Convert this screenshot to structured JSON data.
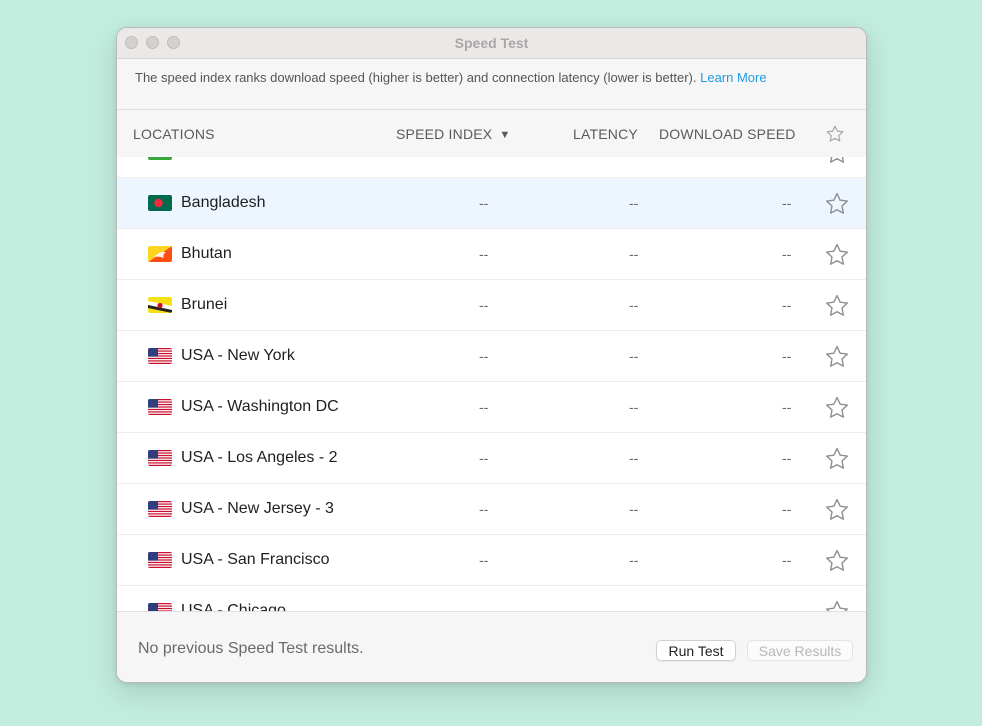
{
  "window": {
    "title": "Speed Test"
  },
  "info": {
    "text": "The speed index ranks download speed (higher is better) and connection latency (lower is better).",
    "link": "Learn More"
  },
  "columns": {
    "locations": "LOCATIONS",
    "speed_index": "SPEED INDEX",
    "sort_arrow": "▼",
    "latency": "LATENCY",
    "download_speed": "DOWNLOAD SPEED"
  },
  "rows": [
    {
      "name": "",
      "flag": "partial-green",
      "speed_index": "",
      "latency": "",
      "download": "",
      "selected": false
    },
    {
      "name": "Bangladesh",
      "flag": "bangladesh",
      "speed_index": "--",
      "latency": "--",
      "download": "--",
      "selected": true
    },
    {
      "name": "Bhutan",
      "flag": "bhutan",
      "speed_index": "--",
      "latency": "--",
      "download": "--",
      "selected": false
    },
    {
      "name": "Brunei",
      "flag": "brunei",
      "speed_index": "--",
      "latency": "--",
      "download": "--",
      "selected": false
    },
    {
      "name": "USA - New York",
      "flag": "usa",
      "speed_index": "--",
      "latency": "--",
      "download": "--",
      "selected": false
    },
    {
      "name": "USA - Washington DC",
      "flag": "usa",
      "speed_index": "--",
      "latency": "--",
      "download": "--",
      "selected": false
    },
    {
      "name": "USA - Los Angeles - 2",
      "flag": "usa",
      "speed_index": "--",
      "latency": "--",
      "download": "--",
      "selected": false
    },
    {
      "name": "USA - New Jersey - 3",
      "flag": "usa",
      "speed_index": "--",
      "latency": "--",
      "download": "--",
      "selected": false
    },
    {
      "name": "USA - San Francisco",
      "flag": "usa",
      "speed_index": "--",
      "latency": "--",
      "download": "--",
      "selected": false
    },
    {
      "name": "USA - Chicago",
      "flag": "usa",
      "speed_index": "--",
      "latency": "--",
      "download": "--",
      "selected": false
    }
  ],
  "footer": {
    "status": "No previous Speed Test results.",
    "run_button": "Run Test",
    "save_button": "Save Results"
  },
  "colors": {
    "background": "#c2ecde",
    "link": "#1f9be0",
    "selected_row": "#edf5fe",
    "star_outline": "#9a9a9a"
  },
  "icons": {
    "favorite": "star-outline-icon",
    "sort": "sort-descending-icon"
  }
}
